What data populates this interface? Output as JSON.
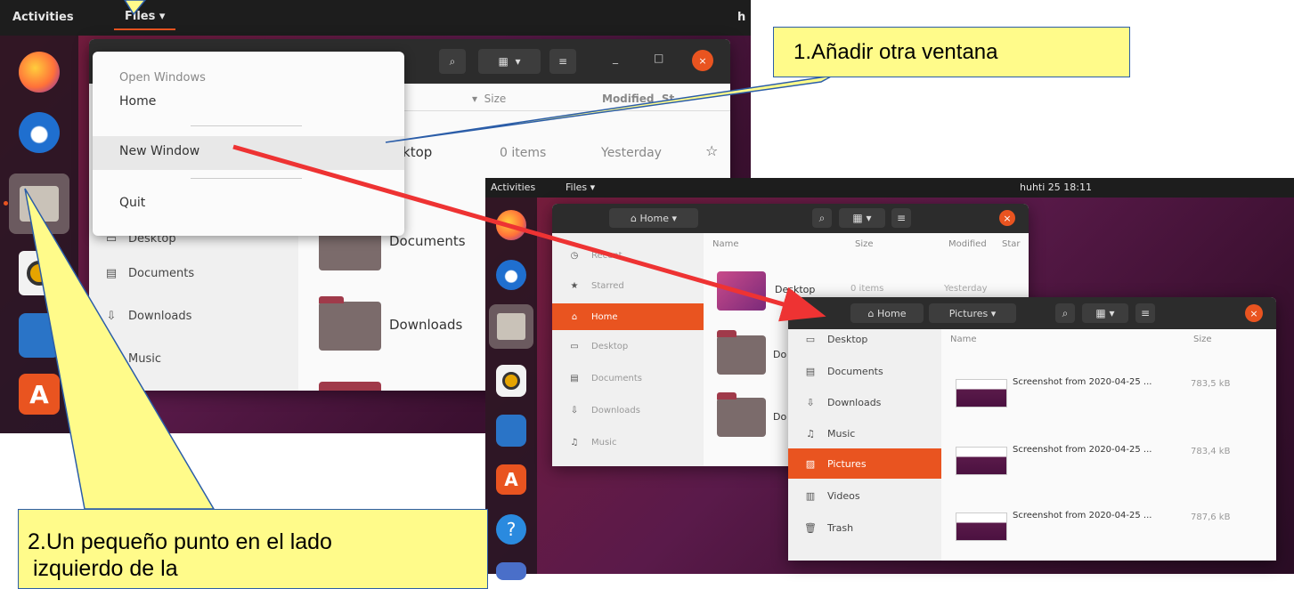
{
  "screenshot1": {
    "topbar": {
      "activities": "Activities",
      "app_menu": "Files ▾",
      "clock_partial": "h"
    },
    "window": {
      "columns": {
        "size": "Size",
        "modified": "Modified",
        "star_partial": "St"
      },
      "rows": [
        {
          "name": "esktop",
          "size": "0 items",
          "modified": "Yesterday"
        },
        {
          "name": "Documents"
        },
        {
          "name": "Downloads"
        }
      ],
      "sidebar": [
        {
          "label": "Desktop",
          "icon": "desktop-icon"
        },
        {
          "label": "Documents",
          "icon": "document-icon"
        },
        {
          "label": "Downloads",
          "icon": "download-icon"
        },
        {
          "label": "Music",
          "icon": "music-icon"
        }
      ]
    },
    "app_menu_popup": {
      "section_label": "Open Windows",
      "items": [
        "Home",
        "New Window",
        "Quit"
      ]
    }
  },
  "screenshot2": {
    "topbar": {
      "activities": "Activities",
      "app_menu": "Files ▾",
      "clock": "huhti 25  18:11"
    },
    "back_window": {
      "path": "Home",
      "columns": {
        "name": "Name",
        "size": "Size",
        "modified": "Modified",
        "star": "Star"
      },
      "sidebar": [
        "Recent",
        "Starred",
        "Home",
        "Desktop",
        "Documents",
        "Downloads",
        "Music"
      ],
      "rows": [
        {
          "name": "Desktop",
          "size": "0 items",
          "modified": "Yesterday"
        },
        {
          "name": "Do"
        },
        {
          "name": "Do"
        }
      ]
    },
    "front_window": {
      "path_home": "Home",
      "path_current": "Pictures",
      "columns": {
        "name": "Name",
        "size": "Size"
      },
      "sidebar": [
        "Desktop",
        "Documents",
        "Downloads",
        "Music",
        "Pictures",
        "Videos",
        "Trash"
      ],
      "files": [
        {
          "name": "Screenshot from 2020-04-25 ...",
          "size": "783,5 kB"
        },
        {
          "name": "Screenshot from 2020-04-25 ...",
          "size": "783,4 kB"
        },
        {
          "name": "Screenshot from 2020-04-25 ...",
          "size": "787,6 kB"
        }
      ]
    }
  },
  "callouts": {
    "one": "1.Añadir otra ventana",
    "two_line1": "2.Un pequeño punto en el lado",
    "two_line2": "izquierdo de la"
  },
  "colors": {
    "accent": "#e95420",
    "callout_fill": "#fffb8a",
    "arrow": "#ee3333"
  }
}
